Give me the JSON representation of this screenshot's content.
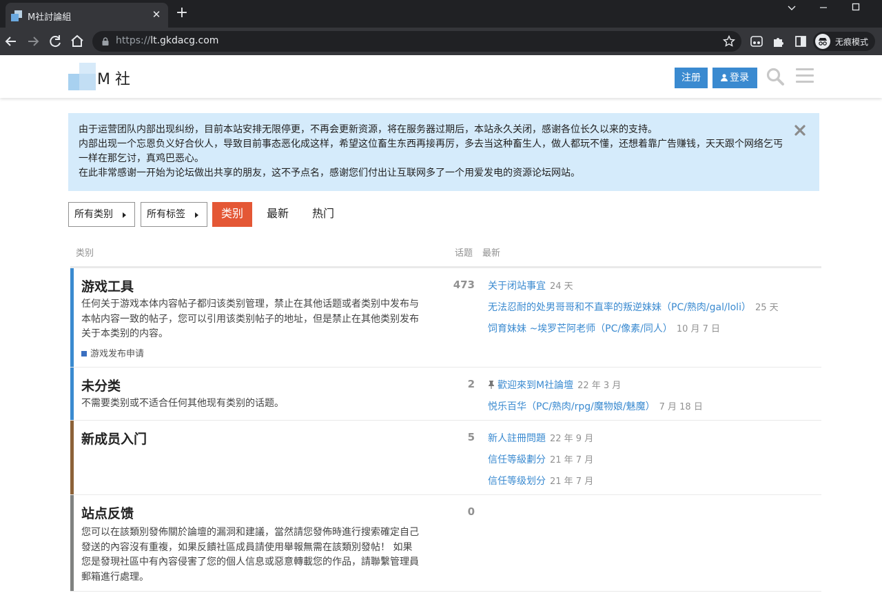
{
  "browser": {
    "tab_title": "M社討論組",
    "url_scheme": "https://",
    "url_host": "lt.gkdacg.com",
    "incognito_label": "无痕模式",
    "icons": [
      "back-icon",
      "forward-icon",
      "reload-icon",
      "home-icon",
      "lock-icon",
      "star-icon",
      "extension-icon",
      "puzzle-icon",
      "sidepanel-icon",
      "incognito-icon"
    ]
  },
  "site": {
    "name": "M 社",
    "signup_label": "注册",
    "login_label": "登录"
  },
  "banner": {
    "lines": [
      "由于运营团队内部出现纠纷，目前本站安排无限停更，不再会更新资源，将在服务器过期后，本站永久关闭，感谢各位长久以来的支持。",
      "内部出现一个忘恩负义好合伙人，导致目前事态恶化成这样，希望这位畜生东西再接再厉，多去当这种畜生人，做人都玩不懂，还想着靠广告赚钱，天天跟个网络乞丐一样在那乞讨，真鸡巴恶心。",
      "在此非常感谢一开始为论坛做出共享的朋友，这不予点名，感谢您们付出让互联网多了一个用爱发电的资源论坛网站。"
    ]
  },
  "nav": {
    "all_categories": "所有类别",
    "all_tags": "所有标签",
    "tabs": [
      "类别",
      "最新",
      "热门"
    ],
    "active_tab": "类别"
  },
  "table": {
    "col_category": "类别",
    "col_topics": "话题",
    "col_latest": "最新"
  },
  "categories": [
    {
      "name": "游戏工具",
      "color": "#3a8ad0",
      "description": "任何关于游戏本体内容帖子都归该类别管理，禁止在其他话题或者类别中发布与本帖内容一致的帖子，您可以引用该类别帖子的地址，但是禁止在其他类别发布关于本类别的内容。",
      "subcategory": "游戏发布申请",
      "topics": "473",
      "latest": [
        {
          "title": "关于闭站事宜",
          "date": "24 天"
        },
        {
          "title": "无法忍耐的处男哥哥和不直率的叛逆妹妹（PC/熟肉/gal/loli）",
          "date": "25 天"
        },
        {
          "title": "饲育妹妹 ~埃罗芒阿老师（PC/像素/同人）",
          "date": "10 月 7 日"
        }
      ]
    },
    {
      "name": "未分类",
      "color": "#3a8ad0",
      "description": "不需要类别或不适合任何其他现有类别的话题。",
      "topics": "2",
      "latest": [
        {
          "title": "歡迎來到M社論壇",
          "date": "22 年 3 月",
          "pinned": true
        },
        {
          "title": "悦乐百华（PC/熟肉/rpg/魔物娘/魅魔）",
          "date": "7 月 18 日"
        }
      ]
    },
    {
      "name": "新成员入门",
      "color": "#8c6238",
      "description": "",
      "topics": "5",
      "latest": [
        {
          "title": "新人註冊問題",
          "date": "22 年 9 月"
        },
        {
          "title": "信任等級劃分",
          "date": "21 年 7 月"
        },
        {
          "title": "信任等级划分",
          "date": "21 年 7 月"
        }
      ]
    },
    {
      "name": "站点反馈",
      "color": "#808281",
      "description": "您可以在該類別發佈關於論壇的漏洞和建議，當然請您發佈時進行搜索確定自己發送的內容沒有重複，如果反饋社區成員請使用舉報無需在該類別發帖！ 如果您是發現社區中有內容侵害了您的個人信息或惡意轉載您的作品，請聯繫管理員郵箱進行處理。",
      "topics": "0",
      "latest": []
    }
  ]
}
